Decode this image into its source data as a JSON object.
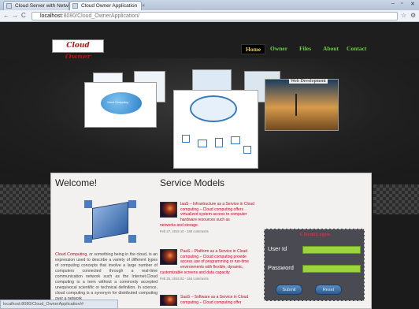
{
  "browser": {
    "tabs": [
      {
        "label": "Cloud Server with Netw",
        "active": false
      },
      {
        "label": "Cloud Owner Application",
        "active": true
      }
    ],
    "url_host": "localhost",
    "url_path": ":8080/Cloud_OwnerApplication/",
    "status_text": "localhost:8080/Cloud_OwnerApplication/#"
  },
  "header": {
    "logo_text": "Cloud Owner",
    "nav": [
      "Home",
      "Owner",
      "Files",
      "About",
      "Contact"
    ],
    "active_nav": "Home"
  },
  "slider": {
    "caption": "Web Development",
    "cloud_label": "Cloud Computing",
    "prev": "‹",
    "next": "›"
  },
  "welcome": {
    "title": "Welcome!",
    "text_highlight": "Cloud Computing,",
    "text": " or something being in the cloud, is an expression used to describe a variety of different types of computing concepts that involve a large number of computers connected through a real-time communication network such as the Internet.Cloud computing is a term without a commonly accepted unequivocal scientific or technical definition. In science, cloud computing is a synonym for distributed computing over a network"
  },
  "services": {
    "title": "Service Models",
    "items": [
      {
        "text": "IaaS – Infrastructure as a Service in Cloud computing – Cloud computing offers virtualized system access to computer hardware resources such as",
        "cont": "networks and storage.",
        "meta": "Feb 27, 2015 10 - 180 comments"
      },
      {
        "text": "PaaS – Platform as a Service in Cloud computing – Cloud computing provide access use of programming or run-time environments with flexible, dynamic,",
        "cont": "customizable screens and data capacity.",
        "meta": "Feb 25, 2015 04 - 154 comments"
      },
      {
        "text": "SaaS – Software as a Service in Cloud computing – Cloud computing offer",
        "cont": "",
        "meta": ""
      }
    ]
  },
  "login": {
    "title": "ClientLogin",
    "user_label": "User Id",
    "password_label": "Password",
    "user_value": "",
    "password_value": "",
    "submit_label": "Submit",
    "reset_label": "Reset"
  }
}
